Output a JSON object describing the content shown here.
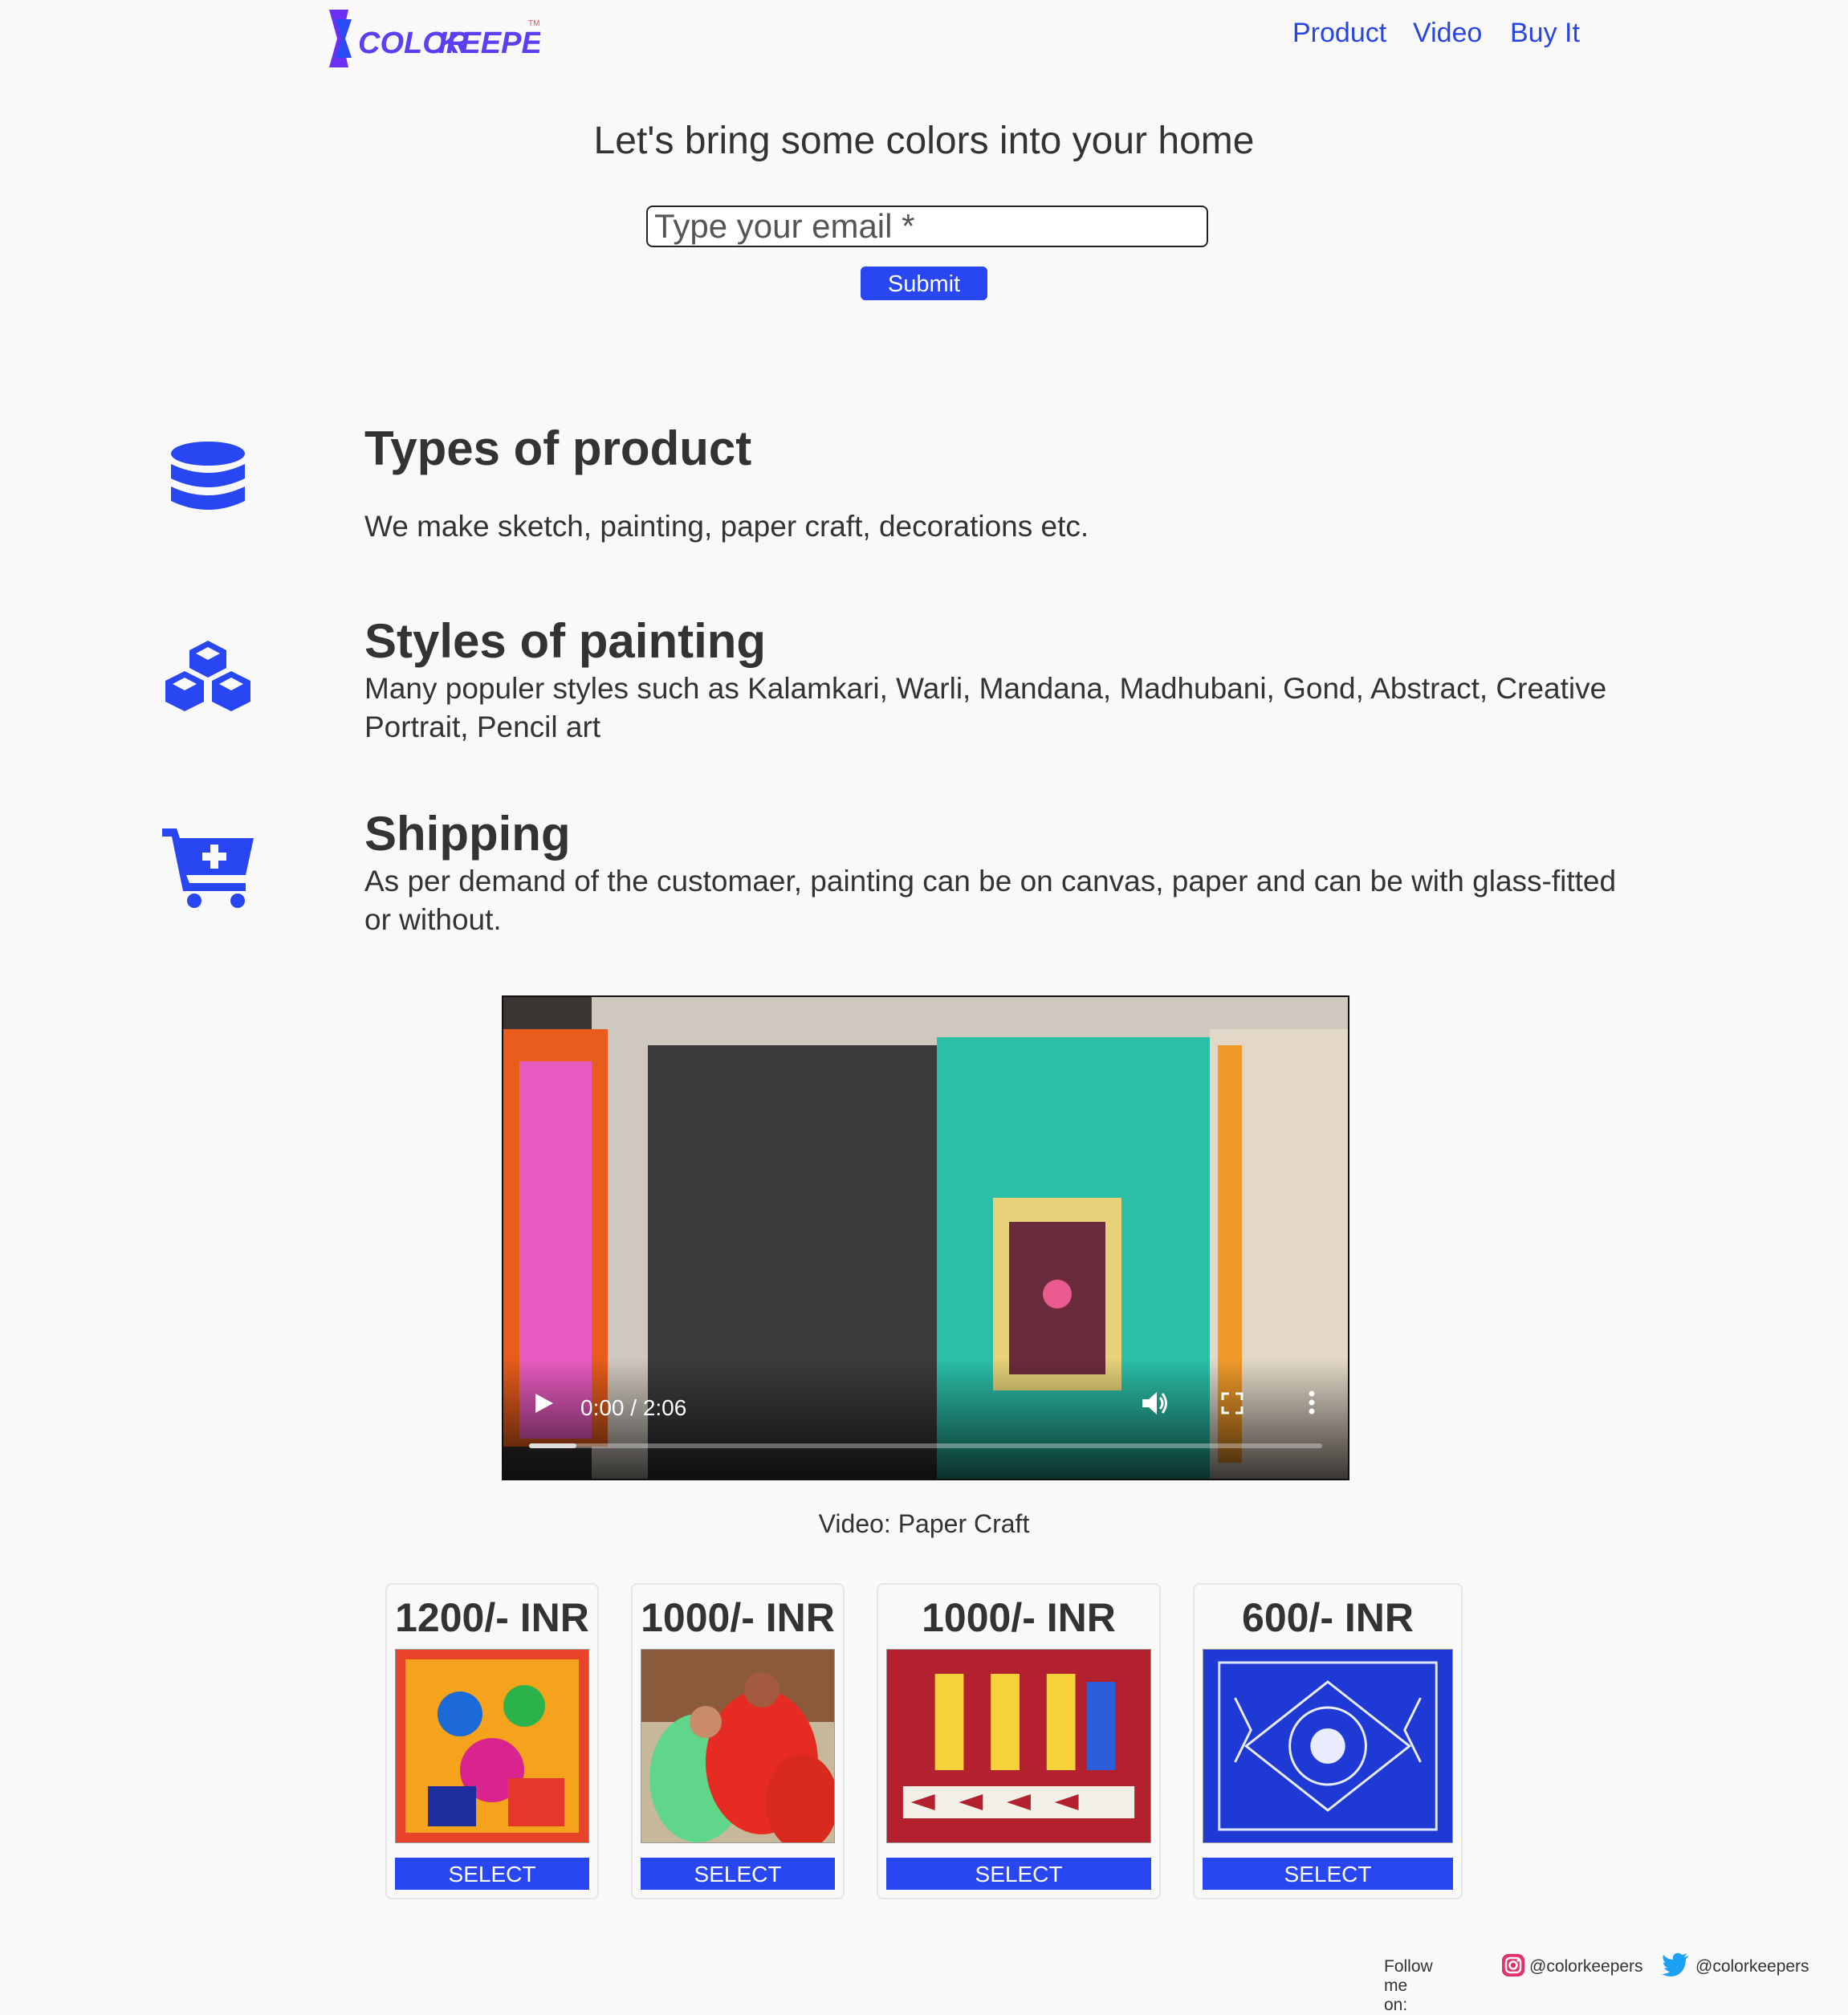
{
  "header": {
    "logo_text_1": "COLOR",
    "logo_text_2": "KEEPERS",
    "logo_tm": "TM",
    "nav": [
      "Product",
      "Video",
      "Buy It"
    ]
  },
  "hero": {
    "title": "Let's bring some colors into your home",
    "email_placeholder": "Type your email *",
    "submit_label": "Submit"
  },
  "features": [
    {
      "icon": "database-icon",
      "title": "Types of product",
      "text": "We make sketch, painting, paper craft, decorations etc."
    },
    {
      "icon": "cubes-icon",
      "title": "Styles of painting",
      "text": "Many populer styles such as Kalamkari, Warli, Mandana, Madhubani, Gond, Abstract, Creative Portrait, Pencil art"
    },
    {
      "icon": "cart-plus-icon",
      "title": "Shipping",
      "text": "As per demand of the customaer, painting can be on canvas, paper and can be with glass-fitted or without."
    }
  ],
  "video": {
    "time": "0:00 / 2:06",
    "caption": "Video: Paper Craft",
    "progress": 0.06
  },
  "products": [
    {
      "price": "1200/- INR",
      "button": "SELECT"
    },
    {
      "price": "1000/- INR",
      "button": "SELECT"
    },
    {
      "price": "1000/- INR",
      "button": "SELECT"
    },
    {
      "price": "600/- INR",
      "button": "SELECT"
    }
  ],
  "footer": {
    "follow_label": "Follow me on:",
    "instagram_handle": "@colorkeepers",
    "twitter_handle": "@colorkeepers"
  },
  "colors": {
    "accent": "#2946f3",
    "nav_link": "#2946e0",
    "background": "#f9f9f9"
  }
}
